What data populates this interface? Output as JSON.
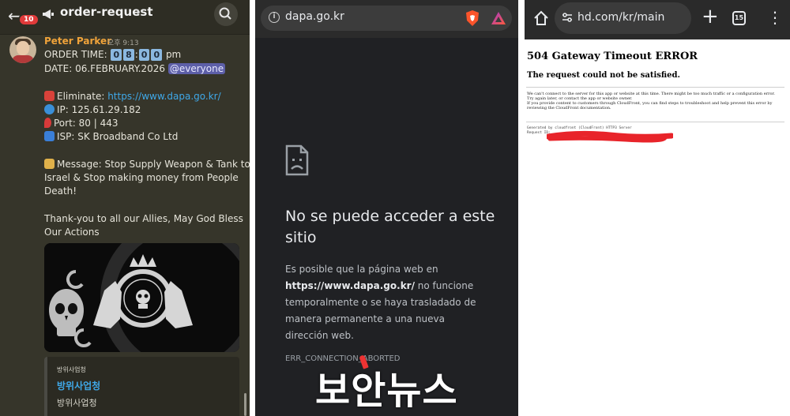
{
  "chat": {
    "unread_badge": "10",
    "channel_name": "order-request",
    "author": "Peter Parker",
    "timestamp": "오후 9:13",
    "order_time_label": "ORDER TIME:",
    "order_time_digits": [
      "0",
      "8",
      "0",
      "0"
    ],
    "order_time_colon": ":",
    "order_time_suffix": "pm",
    "date_label": "DATE: 06.FEBRUARY.2026",
    "mention": "@everyone",
    "eliminate_label": "Eliminate:",
    "eliminate_url": "https://www.dapa.go.kr/",
    "ip": "IP: 125.61.29.182",
    "port": "Port: 80 | 443",
    "isp": "ISP: SK Broadband Co Ltd",
    "message_line1": "Message: Stop Supply Weapon & Tank to",
    "message_line2": "Israel & Stop making money from People",
    "message_line3": "Death!",
    "thanks_line1": "Thank-you to all our Allies, May God Bless",
    "thanks_line2": "Our Actions",
    "embed_provider": "방위사업청",
    "embed_title": "방위사업청",
    "embed_description": "방위사업청"
  },
  "browser_error": {
    "url": "dapa.go.kr",
    "heading_line1": "No se puede acceder a este",
    "heading_line2": "sitio",
    "body_prefix": "Es posible que la página web en",
    "body_url": "https://www.dapa.go.kr/",
    "body_rest": "no funcione temporalmente o se haya trasladado de manera permanente a una nueva dirección web.",
    "error_code": "ERR_CONNECTION_ABORTED",
    "watermark": "보안뉴스"
  },
  "gateway_page": {
    "url": "hd.com/kr/main",
    "tab_count": "15",
    "title": "504 Gateway Timeout ERROR",
    "subtitle": "The request could not be satisfied.",
    "text_line1": "We can't connect to the server for this app or website at this time. There might be too much traffic or a configuration error.",
    "text_line2": "Try again later, or contact the app or website owner.",
    "text_line3": "If you provide content to customers through CloudFront, you can find steps to troubleshoot and help prevent this error by",
    "text_line4": "reviewing the CloudFront documentation.",
    "generated_by": "Generated by cloudfront (CloudFront) HTTP3 Server",
    "request_id_label": "Request ID:"
  },
  "icons": {
    "back": "arrow-left-icon",
    "channel": "megaphone-icon",
    "search": "search-icon",
    "site_info": "info-icon",
    "shield": "brave-shield-icon",
    "rewards": "triangle-icon",
    "sad_page": "sad-page-icon",
    "home": "home-icon",
    "tune": "tune-icon",
    "new_tab": "plus-icon",
    "tabs": "tab-switcher-icon",
    "menu": "more-vertical-icon"
  }
}
